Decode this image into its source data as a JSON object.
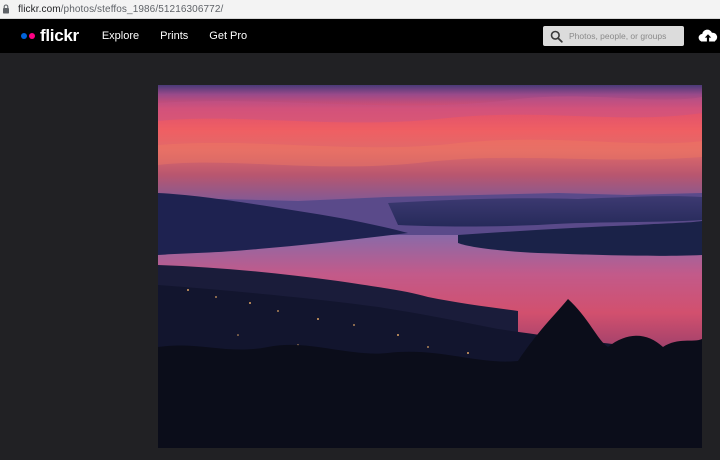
{
  "browser": {
    "url_host": "flickr.com",
    "url_path": "/photos/steffos_1986/51216306772/"
  },
  "nav": {
    "logo_text": "flickr",
    "links": [
      "Explore",
      "Prints",
      "Get Pro"
    ],
    "search_placeholder": "Photos, people, or groups"
  },
  "icons": {
    "lock": "lock-icon",
    "search": "search-icon",
    "upload": "cloud-upload-icon"
  },
  "colors": {
    "flickr_blue": "#0063dc",
    "flickr_pink": "#ff0084",
    "nav_bg": "#000000",
    "page_bg": "#212124"
  }
}
